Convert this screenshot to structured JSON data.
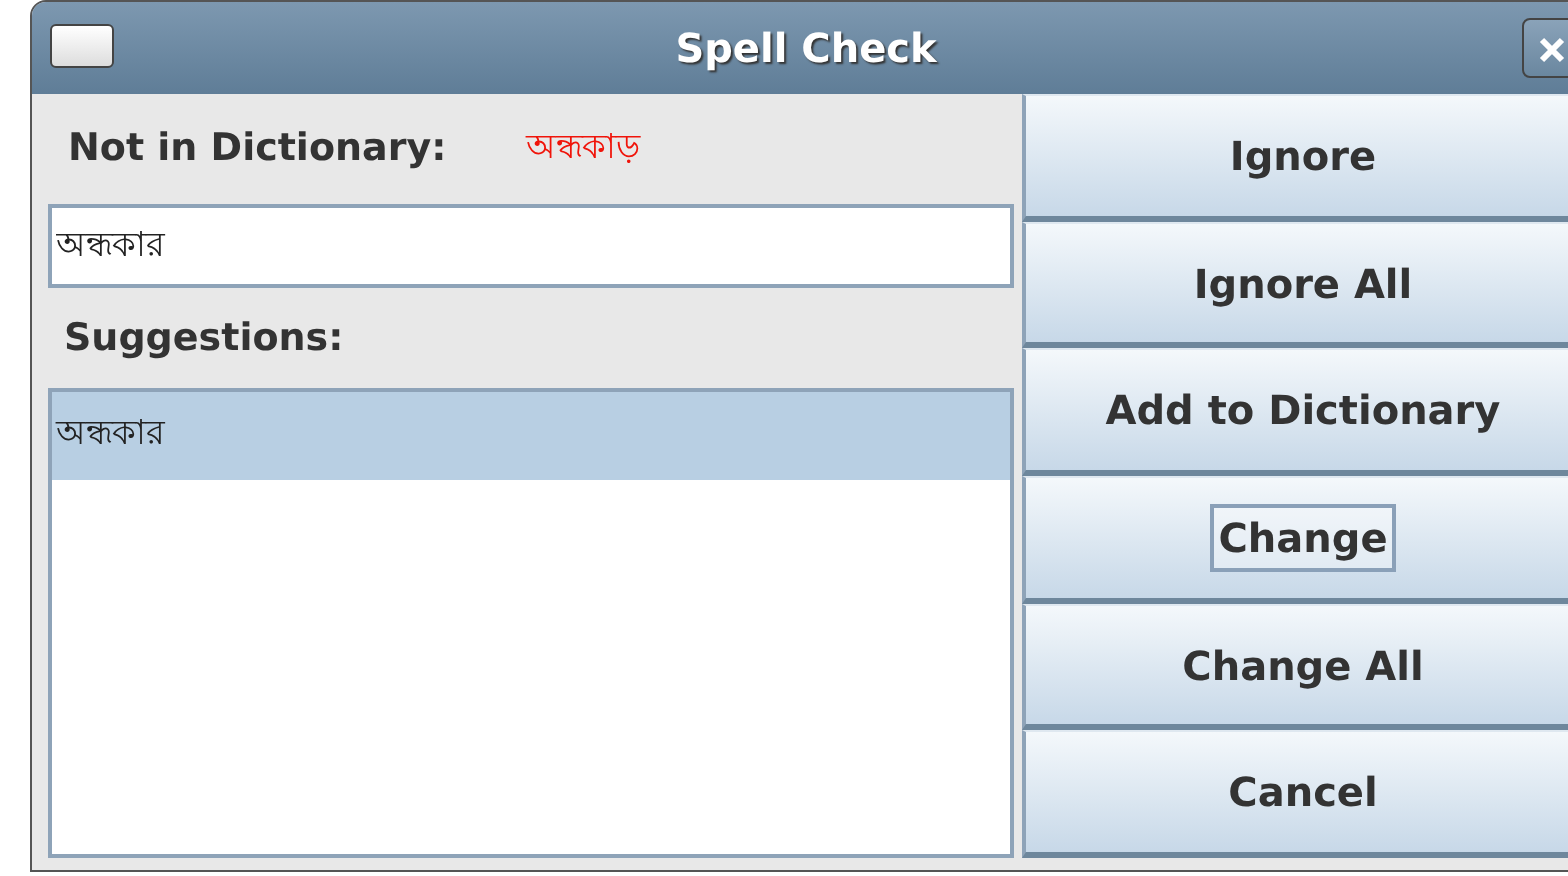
{
  "window": {
    "title": "Spell Check"
  },
  "not_in_dictionary": {
    "label": "Not in Dictionary:",
    "word": "অন্ধকাড়"
  },
  "replacement_field": {
    "value": "অন্ধকার"
  },
  "suggestions": {
    "label": "Suggestions:",
    "items": [
      {
        "text": "অন্ধকার",
        "selected": true
      }
    ]
  },
  "buttons": [
    {
      "label": "Ignore",
      "focused": false
    },
    {
      "label": "Ignore All",
      "focused": false
    },
    {
      "label": "Add to Dictionary",
      "focused": false
    },
    {
      "label": "Change",
      "focused": true
    },
    {
      "label": "Change All",
      "focused": false
    },
    {
      "label": "Cancel",
      "focused": false
    }
  ]
}
